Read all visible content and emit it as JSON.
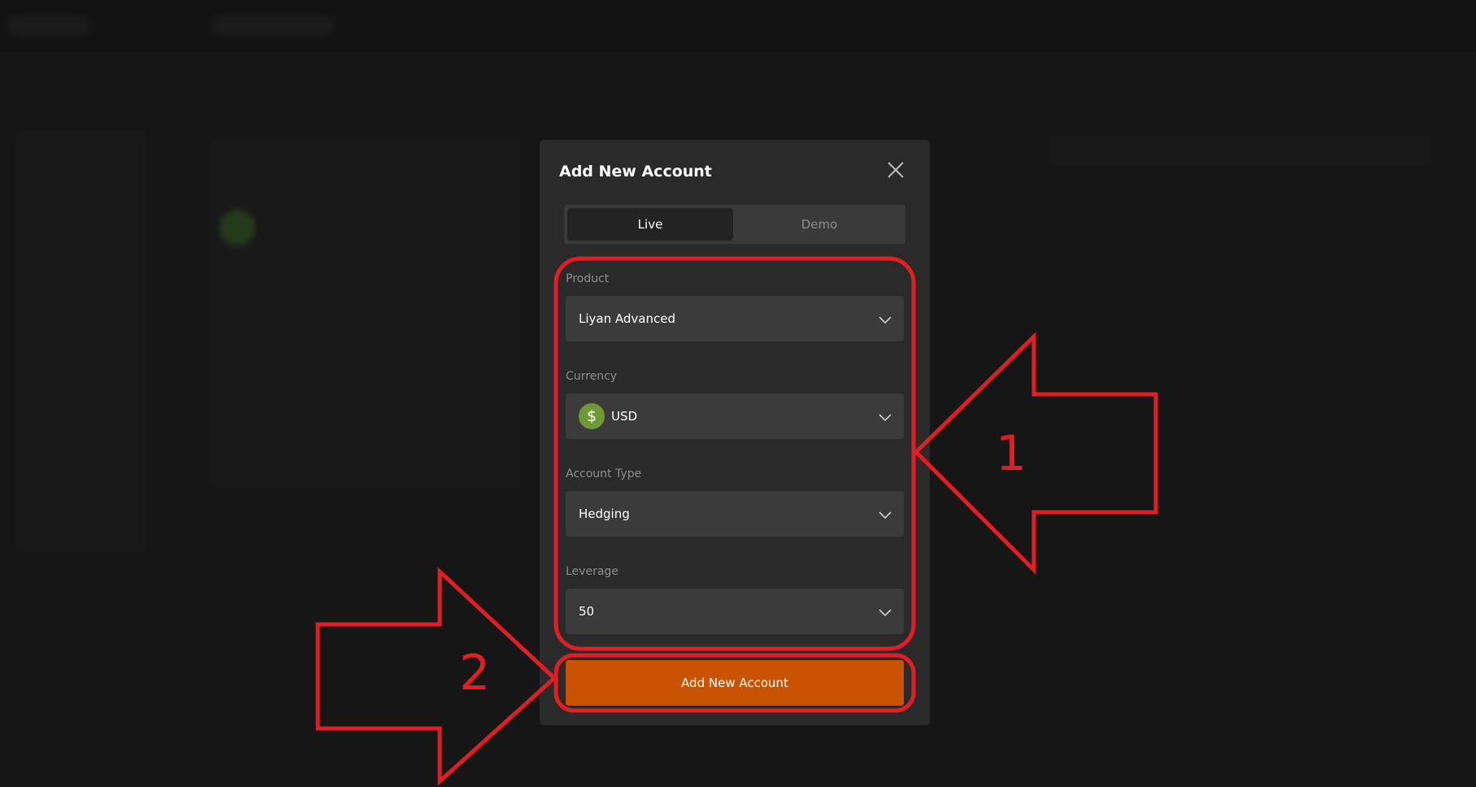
{
  "modal": {
    "title": "Add New Account",
    "tabs": [
      {
        "label": "Live",
        "active": true
      },
      {
        "label": "Demo",
        "active": false
      }
    ],
    "fields": [
      {
        "label": "Product",
        "value": "Liyan Advanced"
      },
      {
        "label": "Currency",
        "value": "USD",
        "icon": "dollar-icon"
      },
      {
        "label": "Account Type",
        "value": "Hedging"
      },
      {
        "label": "Leverage",
        "value": "50"
      }
    ],
    "submit_label": "Add New Account"
  },
  "annotations": {
    "callout_1": "1",
    "callout_2": "2",
    "color": "#e01e25"
  },
  "colors": {
    "accent": "#c95300",
    "currency_icon": "#6e9a34"
  }
}
